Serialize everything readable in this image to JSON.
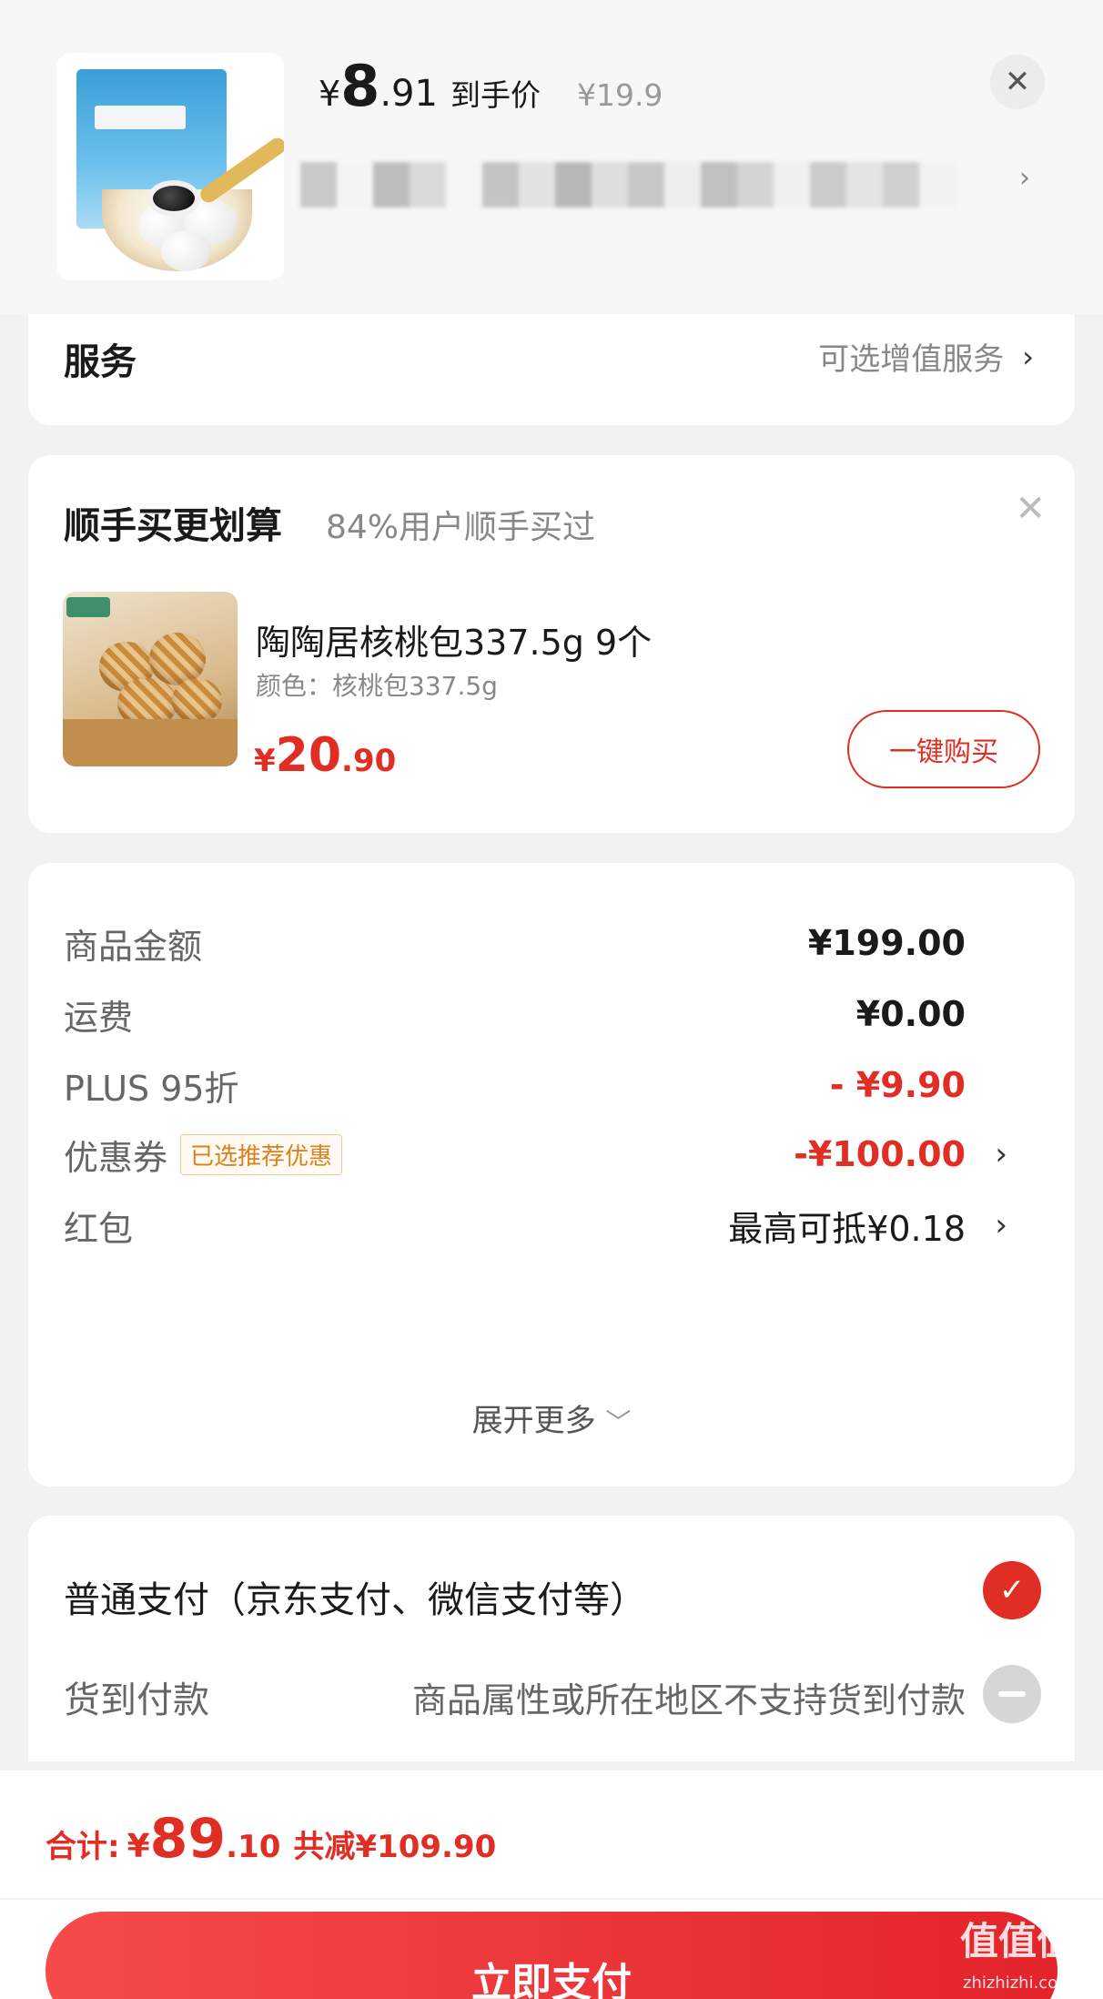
{
  "header": {
    "price_currency": "¥",
    "price_int": "8",
    "price_dec": ".91",
    "price_tag": "到手价",
    "original_price": "¥19.9",
    "close_icon": "close-icon"
  },
  "service": {
    "title": "服务",
    "value": "可选增值服务"
  },
  "addon": {
    "title": "顺手买更划算",
    "subtitle": "84%用户顺手买过",
    "product_name": "陶陶居核桃包337.5g 9个",
    "product_spec": "颜色：核桃包337.5g",
    "price_currency": "¥",
    "price_int": "20",
    "price_dec": ".90",
    "buy_label": "一键购买"
  },
  "summary": {
    "rows": [
      {
        "label": "商品金额",
        "value": "¥199.00"
      },
      {
        "label": "运费",
        "value": "¥0.00"
      },
      {
        "label": "PLUS 95折",
        "value": "- ¥9.90"
      },
      {
        "label": "优惠券",
        "badge": "已选推荐优惠",
        "value": "-¥100.00"
      },
      {
        "label": "红包",
        "value": "最高可抵¥0.18"
      }
    ],
    "expand": "展开更多"
  },
  "payment": {
    "option1": "普通支付（京东支付、微信支付等）",
    "option2_label": "货到付款",
    "option2_note": "商品属性或所在地区不支持货到付款"
  },
  "footer": {
    "total_label": "合计:",
    "total_currency": "¥",
    "total_int": "89",
    "total_dec": ".10",
    "saved": "共减¥109.90",
    "pay_button": "立即支付"
  },
  "watermark": {
    "text": "值值值",
    "domain": "zhizhizhi.com"
  },
  "colors": {
    "accent": "#e02e24",
    "badge_text": "#d9821b"
  }
}
